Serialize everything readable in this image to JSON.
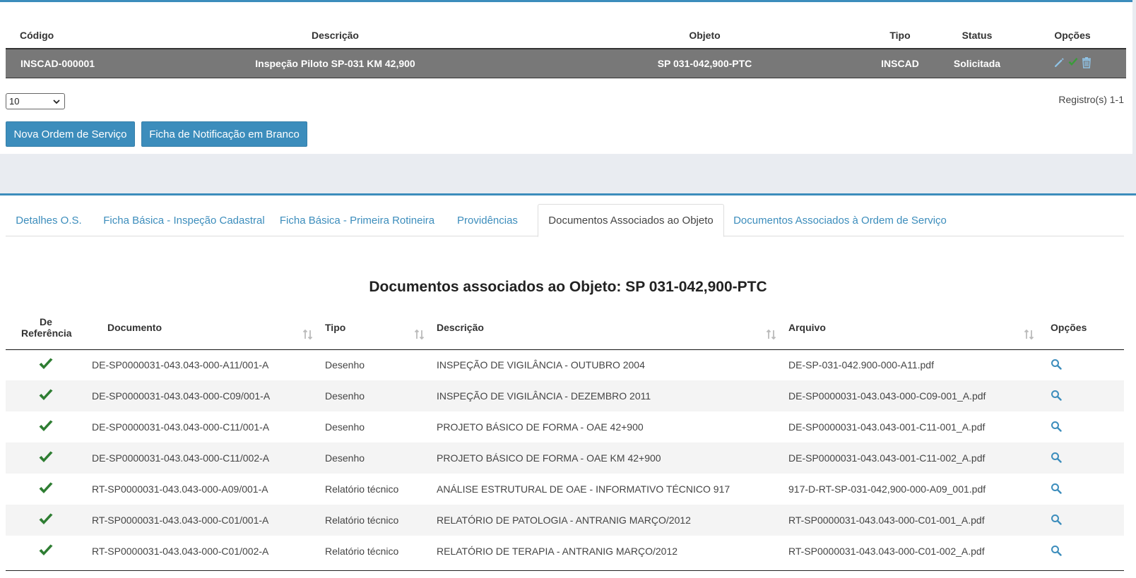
{
  "os_table": {
    "headers": {
      "codigo": "Código",
      "descricao": "Descrição",
      "objeto": "Objeto",
      "tipo": "Tipo",
      "status": "Status",
      "opcoes": "Opções"
    },
    "row": {
      "codigo": "INSCAD-000001",
      "descricao": "Inspeção Piloto SP-031 KM 42,900",
      "objeto": "SP 031-042,900-PTC",
      "tipo": "INSCAD",
      "status": "Solicitada"
    },
    "option_icons": [
      "pencil-icon",
      "check-icon",
      "trash-icon"
    ]
  },
  "pager": {
    "page_size": "10",
    "records": "Registro(s) 1-1"
  },
  "buttons": {
    "new_order": "Nova Ordem de Serviço",
    "blank_form": "Ficha de Notificação em Branco"
  },
  "tabs": [
    {
      "label": "Detalhes O.S.",
      "active": false
    },
    {
      "label": "Ficha Básica - Inspeção Cadastral",
      "active": false
    },
    {
      "label": "Ficha Básica - Primeira Rotineira",
      "active": false
    },
    {
      "label": "Providências",
      "active": false
    },
    {
      "label": "Documentos Associados ao Objeto",
      "active": true
    },
    {
      "label": "Documentos Associados à Ordem de Serviço",
      "active": false
    }
  ],
  "documents": {
    "title": "Documentos associados ao Objeto: SP 031-042,900-PTC",
    "headers": {
      "referencia": "De Referência",
      "documento": "Documento",
      "tipo": "Tipo",
      "descricao": "Descrição",
      "arquivo": "Arquivo",
      "opcoes": "Opções"
    },
    "rows": [
      {
        "referencia": true,
        "documento": "DE-SP0000031-043.043-000-A11/001-A",
        "tipo": "Desenho",
        "descricao": "INSPEÇÃO DE VIGILÂNCIA - OUTUBRO 2004",
        "arquivo": "DE-SP-031-042.900-000-A11.pdf"
      },
      {
        "referencia": true,
        "documento": "DE-SP0000031-043.043-000-C09/001-A",
        "tipo": "Desenho",
        "descricao": "INSPEÇÃO DE VIGILÂNCIA - DEZEMBRO 2011",
        "arquivo": "DE-SP0000031-043.043-000-C09-001_A.pdf"
      },
      {
        "referencia": true,
        "documento": "DE-SP0000031-043.043-000-C11/001-A",
        "tipo": "Desenho",
        "descricao": "PROJETO BÁSICO DE FORMA - OAE 42+900",
        "arquivo": "DE-SP0000031-043.043-001-C11-001_A.pdf"
      },
      {
        "referencia": true,
        "documento": "DE-SP0000031-043.043-000-C11/002-A",
        "tipo": "Desenho",
        "descricao": "PROJETO BÁSICO DE FORMA - OAE KM 42+900",
        "arquivo": "DE-SP0000031-043.043-001-C11-002_A.pdf"
      },
      {
        "referencia": true,
        "documento": "RT-SP0000031-043.043-000-A09/001-A",
        "tipo": "Relatório técnico",
        "descricao": "ANÁLISE ESTRUTURAL DE OAE - INFORMATIVO TÉCNICO 917",
        "arquivo": "917-D-RT-SP-031-042,900-000-A09_001.pdf"
      },
      {
        "referencia": true,
        "documento": "RT-SP0000031-043.043-000-C01/001-A",
        "tipo": "Relatório técnico",
        "descricao": "RELATÓRIO DE PATOLOGIA - ANTRANIG MARÇO/2012",
        "arquivo": "RT-SP0000031-043.043-000-C01-001_A.pdf"
      },
      {
        "referencia": true,
        "documento": "RT-SP0000031-043.043-000-C01/002-A",
        "tipo": "Relatório técnico",
        "descricao": "RELATÓRIO DE TERAPIA - ANTRANIG MARÇO/2012",
        "arquivo": "RT-SP0000031-043.043-000-C01-002_A.pdf"
      }
    ]
  },
  "colors": {
    "accent": "#3c8dbc",
    "check": "#2e7d32",
    "row_selected": "#787878"
  }
}
